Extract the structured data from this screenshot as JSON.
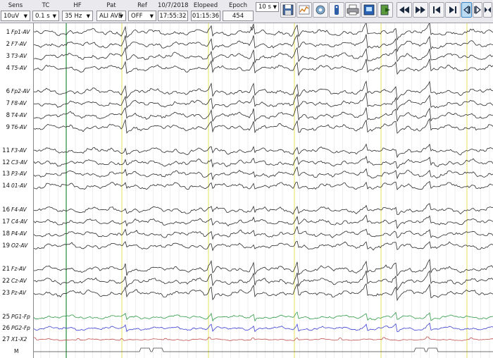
{
  "toolbar": {
    "sens": {
      "label": "Sens",
      "value": "10uV"
    },
    "tc": {
      "label": "TC",
      "value": "0.1 s"
    },
    "hf": {
      "label": "HF",
      "value": "35 Hz"
    },
    "pat": {
      "label": "Pat",
      "value": "ALI AVE"
    },
    "ref": {
      "label": "Ref",
      "value": "OFF"
    },
    "date": {
      "label": "10/7/2018",
      "value": "17:55:32"
    },
    "elapsed": {
      "label": "Elopeed",
      "value": "01:15:36"
    },
    "epoch": {
      "label": "Epoch",
      "value": "454"
    },
    "window": {
      "value": "10 s"
    },
    "icons": [
      "save-icon",
      "chart-icon",
      "settings-icon",
      "info-icon",
      "print-icon",
      "export-icon",
      "exit-icon",
      "fast-rewind-icon",
      "fast-forward-icon",
      "skip-start-icon",
      "skip-end-icon",
      "step-back-icon",
      "step-forward-icon",
      "fit-icon"
    ]
  },
  "channels": [
    {
      "num": "1",
      "name": "Fp1-AV",
      "group": "left-temporal"
    },
    {
      "num": "2",
      "name": "F7-AV",
      "group": "left-temporal"
    },
    {
      "num": "3",
      "name": "T3-AV",
      "group": "left-temporal"
    },
    {
      "num": "4",
      "name": "T5-AV",
      "group": "left-temporal"
    },
    {
      "num": "6",
      "name": "Fp2-AV",
      "group": "right-temporal"
    },
    {
      "num": "7",
      "name": "F8-AV",
      "group": "right-temporal"
    },
    {
      "num": "8",
      "name": "T4-AV",
      "group": "right-temporal"
    },
    {
      "num": "9",
      "name": "T6-AV",
      "group": "right-temporal"
    },
    {
      "num": "11",
      "name": "F3-AV",
      "group": "left-parasagittal"
    },
    {
      "num": "12",
      "name": "C3-AV",
      "group": "left-parasagittal"
    },
    {
      "num": "13",
      "name": "P3-AV",
      "group": "left-parasagittal"
    },
    {
      "num": "14",
      "name": "01-AV",
      "group": "left-parasagittal"
    },
    {
      "num": "16",
      "name": "F4-AV",
      "group": "right-parasagittal"
    },
    {
      "num": "17",
      "name": "C4-AV",
      "group": "right-parasagittal"
    },
    {
      "num": "18",
      "name": "P4-AV",
      "group": "right-parasagittal"
    },
    {
      "num": "19",
      "name": "O2-AV",
      "group": "right-parasagittal"
    },
    {
      "num": "21",
      "name": "Fz-AV",
      "group": "midline"
    },
    {
      "num": "22",
      "name": "Cz-AV",
      "group": "midline"
    },
    {
      "num": "23",
      "name": "Pz-AV",
      "group": "midline"
    },
    {
      "num": "25",
      "name": "PG1-Fp",
      "group": "pg1",
      "color": "#2f9a46"
    },
    {
      "num": "26",
      "name": "PG2-Fp",
      "group": "pg2",
      "color": "#3b3fd1"
    },
    {
      "num": "27",
      "name": "X1-X2",
      "group": "ecg",
      "color": "#c0504d"
    },
    {
      "num": "",
      "name": "M",
      "group": "marker"
    }
  ],
  "colors": {
    "eeg": "#2a2a2a",
    "grid_major": "#e6e25a",
    "grid_minor": "#dcdcdc",
    "cursor": "#2f9a46"
  },
  "marker_text": "v"
}
